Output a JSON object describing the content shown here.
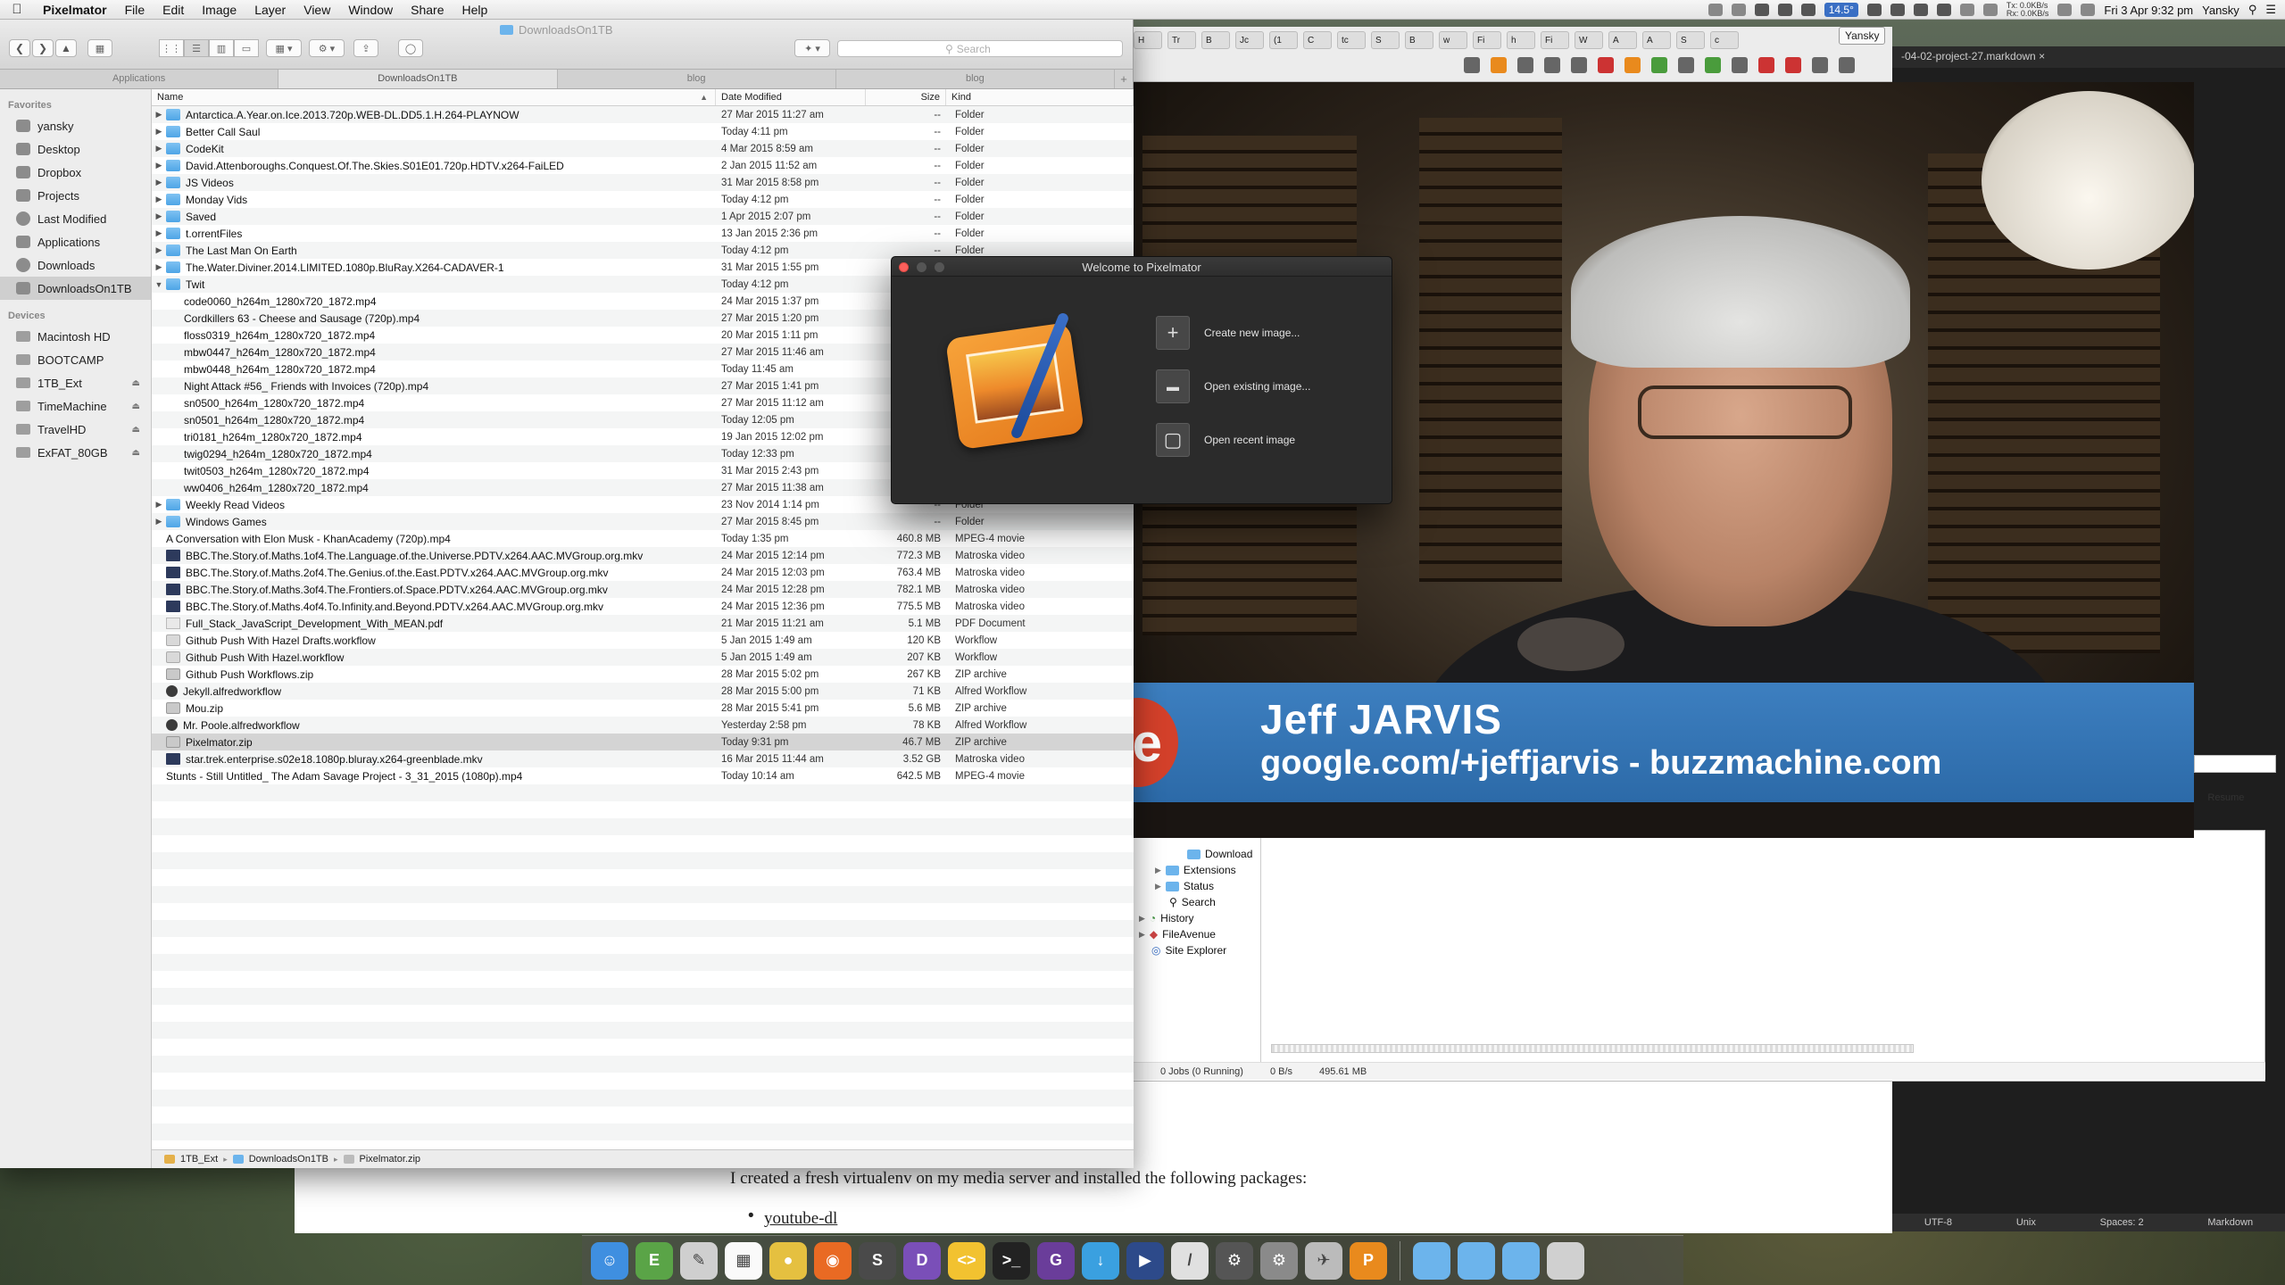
{
  "menubar": {
    "app_name": "Pixelmator",
    "menus": [
      "File",
      "Edit",
      "Image",
      "Layer",
      "View",
      "Window",
      "Share",
      "Help"
    ],
    "temperature": "14.5°",
    "net_tx": "Tx: 0.0KB/s",
    "net_rx": "Rx: 0.0KB/s",
    "datetime": "Fri 3 Apr 9:32 pm",
    "user": "Yansky"
  },
  "finder": {
    "title": "DownloadsOn1TB",
    "search_placeholder": "Search",
    "tabs": [
      "Applications",
      "DownloadsOn1TB",
      "blog",
      "blog"
    ],
    "columns": {
      "name": "Name",
      "date": "Date Modified",
      "size": "Size",
      "kind": "Kind"
    },
    "sidebar": {
      "favorites_header": "Favorites",
      "favorites": [
        "yansky",
        "Desktop",
        "Dropbox",
        "Projects",
        "Last Modified",
        "Applications",
        "Downloads",
        "DownloadsOn1TB"
      ],
      "devices_header": "Devices",
      "devices": [
        "Macintosh HD",
        "BOOTCAMP",
        "1TB_Ext",
        "TimeMachine",
        "TravelHD",
        "ExFAT_80GB"
      ]
    },
    "files": [
      {
        "name": "Antarctica.A.Year.on.Ice.2013.720p.WEB-DL.DD5.1.H.264-PLAYNOW",
        "date": "27 Mar 2015 11:27 am",
        "size": "--",
        "kind": "Folder",
        "icon": "folder",
        "disclosure": "▶",
        "indent": 0
      },
      {
        "name": "Better Call Saul",
        "date": "Today 4:11 pm",
        "size": "--",
        "kind": "Folder",
        "icon": "folder",
        "disclosure": "▶",
        "indent": 0
      },
      {
        "name": "CodeKit",
        "date": "4 Mar 2015 8:59 am",
        "size": "--",
        "kind": "Folder",
        "icon": "folder",
        "disclosure": "▶",
        "indent": 0
      },
      {
        "name": "David.Attenboroughs.Conquest.Of.The.Skies.S01E01.720p.HDTV.x264-FaiLED",
        "date": "2 Jan 2015 11:52 am",
        "size": "--",
        "kind": "Folder",
        "icon": "folder",
        "disclosure": "▶",
        "indent": 0
      },
      {
        "name": "JS Videos",
        "date": "31 Mar 2015 8:58 pm",
        "size": "--",
        "kind": "Folder",
        "icon": "folder",
        "disclosure": "▶",
        "indent": 0
      },
      {
        "name": "Monday Vids",
        "date": "Today 4:12 pm",
        "size": "--",
        "kind": "Folder",
        "icon": "folder",
        "disclosure": "▶",
        "indent": 0
      },
      {
        "name": "Saved",
        "date": "1 Apr 2015 2:07 pm",
        "size": "--",
        "kind": "Folder",
        "icon": "folder",
        "disclosure": "▶",
        "indent": 0
      },
      {
        "name": "t.orrentFiles",
        "date": "13 Jan 2015 2:36 pm",
        "size": "--",
        "kind": "Folder",
        "icon": "folder",
        "disclosure": "▶",
        "indent": 0
      },
      {
        "name": "The Last Man On Earth",
        "date": "Today 4:12 pm",
        "size": "--",
        "kind": "Folder",
        "icon": "folder",
        "disclosure": "▶",
        "indent": 0
      },
      {
        "name": "The.Water.Diviner.2014.LIMITED.1080p.BluRay.X264-CADAVER-1",
        "date": "31 Mar 2015 1:55 pm",
        "size": "--",
        "kind": "Folder",
        "icon": "folder",
        "disclosure": "▶",
        "indent": 0
      },
      {
        "name": "Twit",
        "date": "Today 4:12 pm",
        "size": "--",
        "kind": "Folder",
        "icon": "folder",
        "disclosure": "▼",
        "indent": 0
      },
      {
        "name": "code0060_h264m_1280x720_1872.mp4",
        "date": "24 Mar 2015 1:37 pm",
        "size": "",
        "kind": "",
        "icon": "video",
        "disclosure": "",
        "indent": 1
      },
      {
        "name": "Cordkillers 63 - Cheese and Sausage (720p).mp4",
        "date": "27 Mar 2015 1:20 pm",
        "size": "",
        "kind": "",
        "icon": "video",
        "disclosure": "",
        "indent": 1
      },
      {
        "name": "floss0319_h264m_1280x720_1872.mp4",
        "date": "20 Mar 2015 1:11 pm",
        "size": "",
        "kind": "",
        "icon": "video",
        "disclosure": "",
        "indent": 1
      },
      {
        "name": "mbw0447_h264m_1280x720_1872.mp4",
        "date": "27 Mar 2015 11:46 am",
        "size": "",
        "kind": "",
        "icon": "video",
        "disclosure": "",
        "indent": 1
      },
      {
        "name": "mbw0448_h264m_1280x720_1872.mp4",
        "date": "Today 11:45 am",
        "size": "",
        "kind": "",
        "icon": "video",
        "disclosure": "",
        "indent": 1
      },
      {
        "name": "Night Attack #56_ Friends with Invoices (720p).mp4",
        "date": "27 Mar 2015 1:41 pm",
        "size": "",
        "kind": "",
        "icon": "video",
        "disclosure": "",
        "indent": 1
      },
      {
        "name": "sn0500_h264m_1280x720_1872.mp4",
        "date": "27 Mar 2015 11:12 am",
        "size": "",
        "kind": "",
        "icon": "video",
        "disclosure": "",
        "indent": 1
      },
      {
        "name": "sn0501_h264m_1280x720_1872.mp4",
        "date": "Today 12:05 pm",
        "size": "",
        "kind": "",
        "icon": "video",
        "disclosure": "",
        "indent": 1
      },
      {
        "name": "tri0181_h264m_1280x720_1872.mp4",
        "date": "19 Jan 2015 12:02 pm",
        "size": "",
        "kind": "",
        "icon": "video",
        "disclosure": "",
        "indent": 1
      },
      {
        "name": "twig0294_h264m_1280x720_1872.mp4",
        "date": "Today 12:33 pm",
        "size": "",
        "kind": "",
        "icon": "video",
        "disclosure": "",
        "indent": 1
      },
      {
        "name": "twit0503_h264m_1280x720_1872.mp4",
        "date": "31 Mar 2015 2:43 pm",
        "size": "",
        "kind": "",
        "icon": "video",
        "disclosure": "",
        "indent": 1
      },
      {
        "name": "ww0406_h264m_1280x720_1872.mp4",
        "date": "27 Mar 2015 11:38 am",
        "size": "",
        "kind": "",
        "icon": "video",
        "disclosure": "",
        "indent": 1
      },
      {
        "name": "Weekly Read Videos",
        "date": "23 Nov 2014 1:14 pm",
        "size": "--",
        "kind": "Folder",
        "icon": "folder",
        "disclosure": "▶",
        "indent": 0
      },
      {
        "name": "Windows Games",
        "date": "27 Mar 2015 8:45 pm",
        "size": "--",
        "kind": "Folder",
        "icon": "folder",
        "disclosure": "▶",
        "indent": 0
      },
      {
        "name": "A Conversation with Elon Musk  - KhanAcademy (720p).mp4",
        "date": "Today 1:35 pm",
        "size": "460.8 MB",
        "kind": "MPEG-4 movie",
        "icon": "video",
        "disclosure": "",
        "indent": 0
      },
      {
        "name": "BBC.The.Story.of.Maths.1of4.The.Language.of.the.Universe.PDTV.x264.AAC.MVGroup.org.mkv",
        "date": "24 Mar 2015 12:14 pm",
        "size": "772.3 MB",
        "kind": "Matroska video",
        "icon": "mkv",
        "disclosure": "",
        "indent": 0
      },
      {
        "name": "BBC.The.Story.of.Maths.2of4.The.Genius.of.the.East.PDTV.x264.AAC.MVGroup.org.mkv",
        "date": "24 Mar 2015 12:03 pm",
        "size": "763.4 MB",
        "kind": "Matroska video",
        "icon": "mkv",
        "disclosure": "",
        "indent": 0
      },
      {
        "name": "BBC.The.Story.of.Maths.3of4.The.Frontiers.of.Space.PDTV.x264.AAC.MVGroup.org.mkv",
        "date": "24 Mar 2015 12:28 pm",
        "size": "782.1 MB",
        "kind": "Matroska video",
        "icon": "mkv",
        "disclosure": "",
        "indent": 0
      },
      {
        "name": "BBC.The.Story.of.Maths.4of4.To.Infinity.and.Beyond.PDTV.x264.AAC.MVGroup.org.mkv",
        "date": "24 Mar 2015 12:36 pm",
        "size": "775.5 MB",
        "kind": "Matroska video",
        "icon": "mkv",
        "disclosure": "",
        "indent": 0
      },
      {
        "name": "Full_Stack_JavaScript_Development_With_MEAN.pdf",
        "date": "21 Mar 2015 11:21 am",
        "size": "5.1 MB",
        "kind": "PDF Document",
        "icon": "pdf",
        "disclosure": "",
        "indent": 0
      },
      {
        "name": "Github Push With Hazel Drafts.workflow",
        "date": "5 Jan 2015 1:49 am",
        "size": "120 KB",
        "kind": "Workflow",
        "icon": "workflow",
        "disclosure": "",
        "indent": 0
      },
      {
        "name": "Github Push With Hazel.workflow",
        "date": "5 Jan 2015 1:49 am",
        "size": "207 KB",
        "kind": "Workflow",
        "icon": "workflow",
        "disclosure": "",
        "indent": 0
      },
      {
        "name": "Github Push Workflows.zip",
        "date": "28 Mar 2015 5:02 pm",
        "size": "267 KB",
        "kind": "ZIP archive",
        "icon": "zip",
        "disclosure": "",
        "indent": 0
      },
      {
        "name": "Jekyll.alfredworkflow",
        "date": "28 Mar 2015 5:00 pm",
        "size": "71 KB",
        "kind": "Alfred Workflow",
        "icon": "alfred",
        "disclosure": "",
        "indent": 0
      },
      {
        "name": "Mou.zip",
        "date": "28 Mar 2015 5:41 pm",
        "size": "5.6 MB",
        "kind": "ZIP archive",
        "icon": "zip",
        "disclosure": "",
        "indent": 0
      },
      {
        "name": "Mr. Poole.alfredworkflow",
        "date": "Yesterday 2:58 pm",
        "size": "78 KB",
        "kind": "Alfred Workflow",
        "icon": "alfred",
        "disclosure": "",
        "indent": 0
      },
      {
        "name": "Pixelmator.zip",
        "date": "Today 9:31 pm",
        "size": "46.7 MB",
        "kind": "ZIP archive",
        "icon": "zip",
        "disclosure": "",
        "indent": 0,
        "selected": true
      },
      {
        "name": "star.trek.enterprise.s02e18.1080p.bluray.x264-greenblade.mkv",
        "date": "16 Mar 2015 11:44 am",
        "size": "3.52 GB",
        "kind": "Matroska video",
        "icon": "mkv",
        "disclosure": "",
        "indent": 0
      },
      {
        "name": "Stunts - Still Untitled_ The Adam Savage Project - 3_31_2015 (1080p).mp4",
        "date": "Today 10:14 am",
        "size": "642.5 MB",
        "kind": "MPEG-4 movie",
        "icon": "video",
        "disclosure": "",
        "indent": 0
      }
    ],
    "path_bar": [
      "1TB_Ext",
      "DownloadsOn1TB",
      "Pixelmator.zip"
    ]
  },
  "welcome": {
    "title": "Welcome to Pixelmator",
    "options": [
      {
        "label": "Create new image...",
        "icon": "plus-icon",
        "glyph": "+"
      },
      {
        "label": "Open existing image...",
        "icon": "folder-icon",
        "glyph": "▬"
      },
      {
        "label": "Open recent image",
        "icon": "recent-image-icon",
        "glyph": "▢"
      }
    ]
  },
  "video": {
    "name": "Jeff JARVIS",
    "url": "google.com/+jeffjarvis - buzzmachine.com",
    "logo_letter": "e"
  },
  "browser": {
    "tabs": [
      "H",
      "Tr",
      "B",
      "Jc",
      "(1",
      "C",
      "tc",
      "S",
      "B",
      "w",
      "Fi",
      "h",
      "Fi",
      "W",
      "A",
      "A",
      "S",
      "c"
    ],
    "user_pill": "Yansky"
  },
  "editor": {
    "tab_label": "-04-02-project-27.markdown",
    "status": [
      "UTF-8",
      "Unix",
      "Spaces: 2",
      "Markdown"
    ],
    "blog_paragraph": "I created a fresh virtualenv on my media server and installed the following packages:",
    "blog_link": "youtube-dl"
  },
  "downloads": {
    "tree": [
      "Download",
      "Extensions",
      "Status",
      "Search",
      "History",
      "FileAvenue",
      "Site Explorer"
    ],
    "jobs": "0 Jobs (0 Running)",
    "speed": "0 B/s",
    "total": "495.61 MB",
    "col_label_1": "e",
    "col_label_2": "Resume"
  },
  "dock": {
    "apps": [
      {
        "name": "finder-app",
        "color": "#3f8fe0",
        "glyph": "☺"
      },
      {
        "name": "evernote-app",
        "color": "#5aa447",
        "glyph": "E"
      },
      {
        "name": "app-icon-3",
        "color": "#cfcfcf",
        "glyph": "✎"
      },
      {
        "name": "calendar-app",
        "color": "#fafafa",
        "glyph": "▦"
      },
      {
        "name": "chrome-app",
        "color": "#e5c040",
        "glyph": "●"
      },
      {
        "name": "firefox-app",
        "color": "#e96a23",
        "glyph": "◉"
      },
      {
        "name": "sublime-app",
        "color": "#4a4a4a",
        "glyph": "S"
      },
      {
        "name": "dash-app",
        "color": "#7a4fb8",
        "glyph": "D"
      },
      {
        "name": "codekit-app",
        "color": "#f2c230",
        "glyph": "<>"
      },
      {
        "name": "terminal-app",
        "color": "#222222",
        "glyph": ">_"
      },
      {
        "name": "github-app",
        "color": "#6a3d9a",
        "glyph": "G"
      },
      {
        "name": "downloads-app",
        "color": "#3aa0e0",
        "glyph": "↓"
      },
      {
        "name": "app-icon-13",
        "color": "#2d4a8a",
        "glyph": "▶"
      },
      {
        "name": "app-icon-14",
        "color": "#e0e0e0",
        "glyph": "/"
      },
      {
        "name": "app-icon-15",
        "color": "#555555",
        "glyph": "⚙"
      },
      {
        "name": "system-prefs-app",
        "color": "#8a8a8a",
        "glyph": "⚙"
      },
      {
        "name": "app-icon-17",
        "color": "#bbbbbb",
        "glyph": "✈"
      },
      {
        "name": "pixelmator-app",
        "color": "#e98a1d",
        "glyph": "P"
      }
    ],
    "folders": [
      {
        "name": "applications-stack",
        "color": "#6cb4ec"
      },
      {
        "name": "documents-stack",
        "color": "#6cb4ec"
      },
      {
        "name": "downloads-stack",
        "color": "#6cb4ec"
      },
      {
        "name": "trash",
        "color": "#d0d0d0"
      }
    ]
  }
}
